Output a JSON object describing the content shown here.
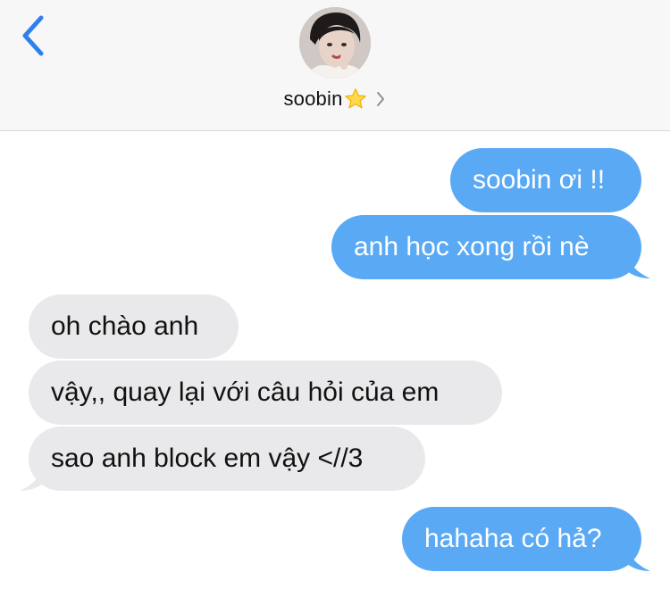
{
  "header": {
    "contact_name": "soobin",
    "star_emoji": "⭐",
    "back_icon": "chevron-left-icon",
    "details_icon": "chevron-right-icon"
  },
  "colors": {
    "accent": "#2f80ed",
    "sent_bubble": "#5aa9f5",
    "received_bubble": "#e9e9eb",
    "header_bg": "#f7f7f7"
  },
  "messages": [
    {
      "direction": "sent",
      "text": "soobin ơi !!"
    },
    {
      "direction": "sent",
      "text": "anh học xong rồi nè"
    },
    {
      "direction": "received",
      "text": "oh chào anh"
    },
    {
      "direction": "received",
      "text": "vậy,, quay lại với câu hỏi của em"
    },
    {
      "direction": "received",
      "text": "sao anh block em vậy <//3"
    },
    {
      "direction": "sent",
      "text": "hahaha có hả?"
    }
  ]
}
